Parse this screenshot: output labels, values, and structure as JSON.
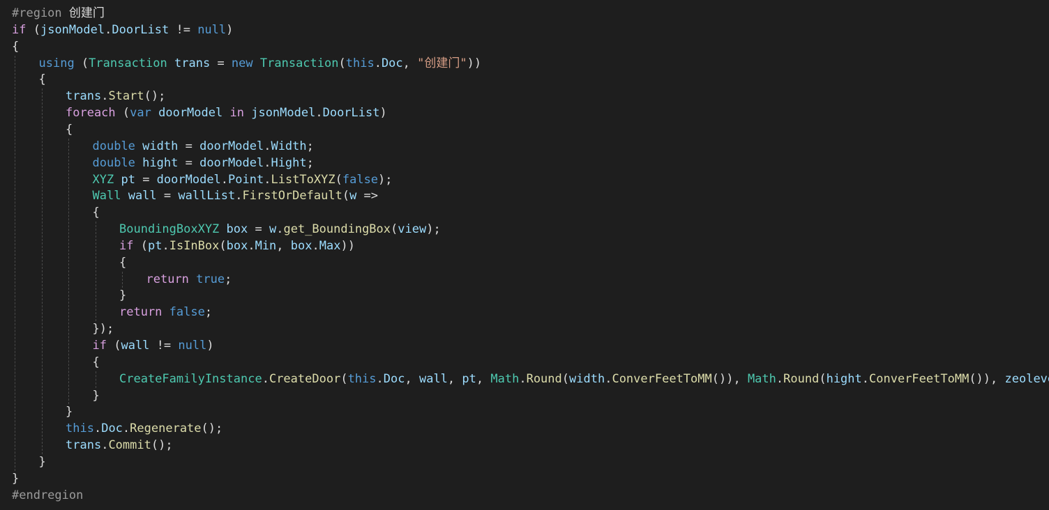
{
  "editor": {
    "language": "C#",
    "theme_colors": {
      "background": "#1e1e1e",
      "keyword": "#569cd6",
      "control_keyword": "#d8a0df",
      "type": "#4ec9b0",
      "identifier": "#9cdcfe",
      "method": "#dcdcaa",
      "string": "#d69d85",
      "preprocessor": "#9b9b9b",
      "punctuation": "#dcdcdc"
    },
    "lines": [
      {
        "indent": 0,
        "tokens": [
          [
            "pp",
            "#region "
          ],
          [
            "pu",
            "创建门"
          ]
        ]
      },
      {
        "indent": 0,
        "tokens": [
          [
            "ctl",
            "if"
          ],
          [
            "pu",
            " ("
          ],
          [
            "id",
            "jsonModel"
          ],
          [
            "pu",
            "."
          ],
          [
            "id",
            "DoorList"
          ],
          [
            "pu",
            " != "
          ],
          [
            "kw",
            "null"
          ],
          [
            "pu",
            ")"
          ]
        ]
      },
      {
        "indent": 0,
        "tokens": [
          [
            "pu",
            "{"
          ]
        ]
      },
      {
        "indent": 1,
        "tokens": [
          [
            "kw",
            "using"
          ],
          [
            "pu",
            " ("
          ],
          [
            "ty",
            "Transaction"
          ],
          [
            "pu",
            " "
          ],
          [
            "id",
            "trans"
          ],
          [
            "pu",
            " = "
          ],
          [
            "kw",
            "new"
          ],
          [
            "pu",
            " "
          ],
          [
            "ty",
            "Transaction"
          ],
          [
            "pu",
            "("
          ],
          [
            "kw",
            "this"
          ],
          [
            "pu",
            "."
          ],
          [
            "id",
            "Doc"
          ],
          [
            "pu",
            ", "
          ],
          [
            "st",
            "\"创建门\""
          ],
          [
            "pu",
            "))"
          ]
        ]
      },
      {
        "indent": 1,
        "tokens": [
          [
            "pu",
            "{"
          ]
        ]
      },
      {
        "indent": 2,
        "tokens": [
          [
            "id",
            "trans"
          ],
          [
            "pu",
            "."
          ],
          [
            "mt",
            "Start"
          ],
          [
            "pu",
            "();"
          ]
        ]
      },
      {
        "indent": 2,
        "tokens": [
          [
            "ctl",
            "foreach"
          ],
          [
            "pu",
            " ("
          ],
          [
            "kw",
            "var"
          ],
          [
            "pu",
            " "
          ],
          [
            "id",
            "doorModel"
          ],
          [
            "pu",
            " "
          ],
          [
            "ctl",
            "in"
          ],
          [
            "pu",
            " "
          ],
          [
            "id",
            "jsonModel"
          ],
          [
            "pu",
            "."
          ],
          [
            "id",
            "DoorList"
          ],
          [
            "pu",
            ")"
          ]
        ]
      },
      {
        "indent": 2,
        "tokens": [
          [
            "pu",
            "{"
          ]
        ]
      },
      {
        "indent": 3,
        "tokens": [
          [
            "kw",
            "double"
          ],
          [
            "pu",
            " "
          ],
          [
            "id",
            "width"
          ],
          [
            "pu",
            " = "
          ],
          [
            "id",
            "doorModel"
          ],
          [
            "pu",
            "."
          ],
          [
            "id",
            "Width"
          ],
          [
            "pu",
            ";"
          ]
        ]
      },
      {
        "indent": 3,
        "tokens": [
          [
            "kw",
            "double"
          ],
          [
            "pu",
            " "
          ],
          [
            "id",
            "hight"
          ],
          [
            "pu",
            " = "
          ],
          [
            "id",
            "doorModel"
          ],
          [
            "pu",
            "."
          ],
          [
            "id",
            "Hight"
          ],
          [
            "pu",
            ";"
          ]
        ]
      },
      {
        "indent": 3,
        "tokens": [
          [
            "ty",
            "XYZ"
          ],
          [
            "pu",
            " "
          ],
          [
            "id",
            "pt"
          ],
          [
            "pu",
            " = "
          ],
          [
            "id",
            "doorModel"
          ],
          [
            "pu",
            "."
          ],
          [
            "id",
            "Point"
          ],
          [
            "pu",
            "."
          ],
          [
            "mt",
            "ListToXYZ"
          ],
          [
            "pu",
            "("
          ],
          [
            "kw",
            "false"
          ],
          [
            "pu",
            ");"
          ]
        ]
      },
      {
        "indent": 3,
        "tokens": [
          [
            "ty",
            "Wall"
          ],
          [
            "pu",
            " "
          ],
          [
            "id",
            "wall"
          ],
          [
            "pu",
            " = "
          ],
          [
            "id",
            "wallList"
          ],
          [
            "pu",
            "."
          ],
          [
            "mt",
            "FirstOrDefault"
          ],
          [
            "pu",
            "("
          ],
          [
            "id",
            "w"
          ],
          [
            "pu",
            " =>"
          ]
        ]
      },
      {
        "indent": 3,
        "tokens": [
          [
            "pu",
            "{"
          ]
        ]
      },
      {
        "indent": 4,
        "tokens": [
          [
            "ty",
            "BoundingBoxXYZ"
          ],
          [
            "pu",
            " "
          ],
          [
            "id",
            "box"
          ],
          [
            "pu",
            " = "
          ],
          [
            "id",
            "w"
          ],
          [
            "pu",
            "."
          ],
          [
            "mt",
            "get_BoundingBox"
          ],
          [
            "pu",
            "("
          ],
          [
            "id",
            "view"
          ],
          [
            "pu",
            ");"
          ]
        ]
      },
      {
        "indent": 4,
        "tokens": [
          [
            "ctl",
            "if"
          ],
          [
            "pu",
            " ("
          ],
          [
            "id",
            "pt"
          ],
          [
            "pu",
            "."
          ],
          [
            "mt",
            "IsInBox"
          ],
          [
            "pu",
            "("
          ],
          [
            "id",
            "box"
          ],
          [
            "pu",
            "."
          ],
          [
            "id",
            "Min"
          ],
          [
            "pu",
            ", "
          ],
          [
            "id",
            "box"
          ],
          [
            "pu",
            "."
          ],
          [
            "id",
            "Max"
          ],
          [
            "pu",
            "))"
          ]
        ]
      },
      {
        "indent": 4,
        "tokens": [
          [
            "pu",
            "{"
          ]
        ]
      },
      {
        "indent": 5,
        "tokens": [
          [
            "ctl",
            "return"
          ],
          [
            "pu",
            " "
          ],
          [
            "kw",
            "true"
          ],
          [
            "pu",
            ";"
          ]
        ]
      },
      {
        "indent": 4,
        "tokens": [
          [
            "pu",
            "}"
          ]
        ]
      },
      {
        "indent": 4,
        "tokens": [
          [
            "ctl",
            "return"
          ],
          [
            "pu",
            " "
          ],
          [
            "kw",
            "false"
          ],
          [
            "pu",
            ";"
          ]
        ]
      },
      {
        "indent": 3,
        "tokens": [
          [
            "pu",
            "});"
          ]
        ]
      },
      {
        "indent": 3,
        "tokens": [
          [
            "ctl",
            "if"
          ],
          [
            "pu",
            " ("
          ],
          [
            "id",
            "wall"
          ],
          [
            "pu",
            " != "
          ],
          [
            "kw",
            "null"
          ],
          [
            "pu",
            ")"
          ]
        ]
      },
      {
        "indent": 3,
        "tokens": [
          [
            "pu",
            "{"
          ]
        ]
      },
      {
        "indent": 4,
        "tokens": [
          [
            "ty",
            "CreateFamilyInstance"
          ],
          [
            "pu",
            "."
          ],
          [
            "mt",
            "CreateDoor"
          ],
          [
            "pu",
            "("
          ],
          [
            "kw",
            "this"
          ],
          [
            "pu",
            "."
          ],
          [
            "id",
            "Doc"
          ],
          [
            "pu",
            ", "
          ],
          [
            "id",
            "wall"
          ],
          [
            "pu",
            ", "
          ],
          [
            "id",
            "pt"
          ],
          [
            "pu",
            ", "
          ],
          [
            "ty",
            "Math"
          ],
          [
            "pu",
            "."
          ],
          [
            "mt",
            "Round"
          ],
          [
            "pu",
            "("
          ],
          [
            "id",
            "width"
          ],
          [
            "pu",
            "."
          ],
          [
            "mt",
            "ConverFeetToMM"
          ],
          [
            "pu",
            "()), "
          ],
          [
            "ty",
            "Math"
          ],
          [
            "pu",
            "."
          ],
          [
            "mt",
            "Round"
          ],
          [
            "pu",
            "("
          ],
          [
            "id",
            "hight"
          ],
          [
            "pu",
            "."
          ],
          [
            "mt",
            "ConverFeetToMM"
          ],
          [
            "pu",
            "()), "
          ],
          [
            "id",
            "zeolevel"
          ],
          [
            "pu",
            ");"
          ]
        ]
      },
      {
        "indent": 3,
        "tokens": [
          [
            "pu",
            "}"
          ]
        ]
      },
      {
        "indent": 2,
        "tokens": [
          [
            "pu",
            "}"
          ]
        ]
      },
      {
        "indent": 2,
        "tokens": [
          [
            "kw",
            "this"
          ],
          [
            "pu",
            "."
          ],
          [
            "id",
            "Doc"
          ],
          [
            "pu",
            "."
          ],
          [
            "mt",
            "Regenerate"
          ],
          [
            "pu",
            "();"
          ]
        ]
      },
      {
        "indent": 2,
        "tokens": [
          [
            "id",
            "trans"
          ],
          [
            "pu",
            "."
          ],
          [
            "mt",
            "Commit"
          ],
          [
            "pu",
            "();"
          ]
        ]
      },
      {
        "indent": 1,
        "tokens": [
          [
            "pu",
            "}"
          ]
        ]
      },
      {
        "indent": 0,
        "tokens": [
          [
            "pu",
            "}"
          ]
        ]
      },
      {
        "indent": 0,
        "tokens": [
          [
            "pp",
            "#endregion"
          ]
        ]
      }
    ]
  }
}
